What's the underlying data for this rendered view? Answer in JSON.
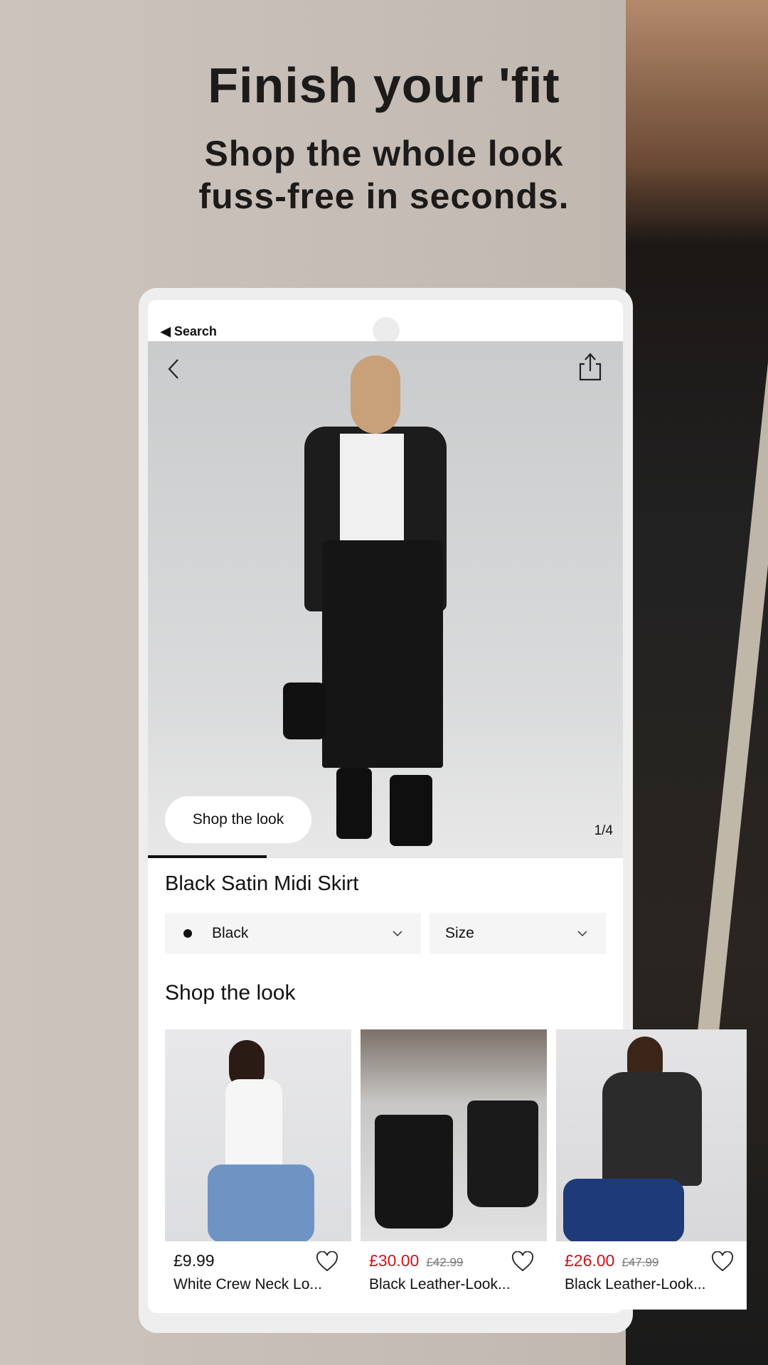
{
  "headline": {
    "title": "Finish your 'fit",
    "subtitle_line1": "Shop the whole look",
    "subtitle_line2": "fuss-free in seconds."
  },
  "status_bar": {
    "back_label": "◀ Search"
  },
  "hero": {
    "back_icon": "chevron-left-icon",
    "share_icon": "share-icon",
    "shop_the_look_button": "Shop the look",
    "image_counter": "1/4",
    "gallery_progress": 0.25
  },
  "product": {
    "title": "Black Satin Midi Skirt",
    "color_select": {
      "selected": "Black",
      "swatch": "#111111"
    },
    "size_select": {
      "placeholder": "Size"
    }
  },
  "shop_the_look": {
    "heading": "Shop the look",
    "items": [
      {
        "price": "£9.99",
        "was_price": "",
        "on_sale": false,
        "name": "White Crew Neck Lo..."
      },
      {
        "price": "£30.00",
        "was_price": "£42.99",
        "on_sale": true,
        "name": "Black Leather-Look..."
      },
      {
        "price": "£26.00",
        "was_price": "£47.99",
        "on_sale": true,
        "name": "Black Leather-Look..."
      }
    ]
  },
  "colors": {
    "sale_red": "#d0121b",
    "text": "#111111",
    "select_bg": "#f5f5f5"
  }
}
